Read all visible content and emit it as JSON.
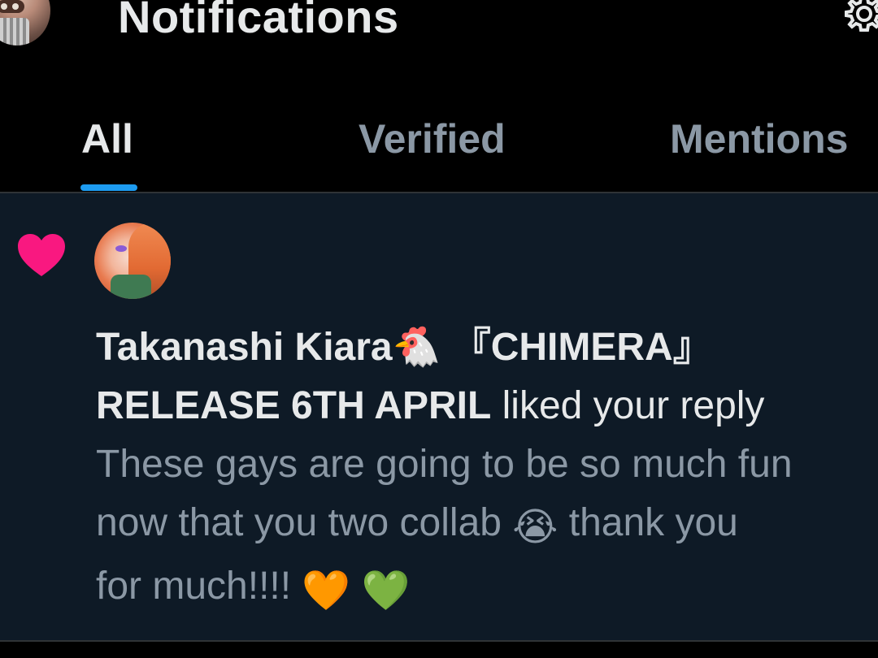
{
  "header": {
    "title": "Notifications",
    "settings_icon": "gear-icon"
  },
  "tabs": [
    {
      "label": "All",
      "active": true
    },
    {
      "label": "Verified",
      "active": false
    },
    {
      "label": "Mentions",
      "active": false
    }
  ],
  "notification": {
    "type_icon": "heart-icon",
    "accent_color": "#f91880",
    "user_name_line1": "Takanashi Kiara🐔 『CHIMERA』",
    "user_name_line2": "RELEASE 6TH APRIL",
    "action": " liked your reply",
    "excerpt_line1": "These gays are going to be so much fun",
    "excerpt_line2a": "now that you two collab ",
    "excerpt_line2_emoji": "😭",
    "excerpt_line2b": " thank you",
    "excerpt_line3a": "for much!!!! ",
    "excerpt_line3_emoji1": "🧡",
    "excerpt_line3_emoji2": "💚"
  },
  "colors": {
    "background": "#000000",
    "item_background": "#0e1a26",
    "text_primary": "#e7e9ea",
    "text_secondary": "#8b98a5",
    "tab_indicator": "#1d9bf0"
  }
}
